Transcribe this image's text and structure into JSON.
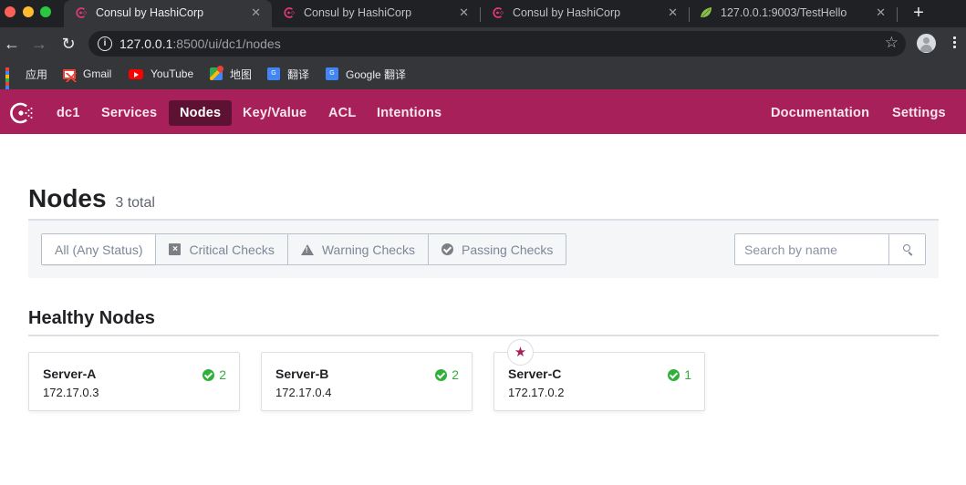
{
  "browser": {
    "tabs": [
      {
        "title": "Consul by HashiCorp",
        "favicon": "consul-icon",
        "active": true
      },
      {
        "title": "Consul by HashiCorp",
        "favicon": "consul-icon",
        "active": false
      },
      {
        "title": "Consul by HashiCorp",
        "favicon": "consul-icon",
        "active": false
      },
      {
        "title": "127.0.0.1:9003/TestHello",
        "favicon": "spring-leaf-icon",
        "active": false
      }
    ],
    "new_tab_label": "+",
    "close_glyph": "✕",
    "url_host": "127.0.0.1",
    "url_rest": ":8500/ui/dc1/nodes",
    "bookmarks": [
      {
        "label": "应用",
        "icon": "apps-grid-icon"
      },
      {
        "label": "Gmail",
        "icon": "gmail-icon"
      },
      {
        "label": "YouTube",
        "icon": "youtube-icon"
      },
      {
        "label": "地图",
        "icon": "maps-icon"
      },
      {
        "label": "翻译",
        "icon": "translate-icon"
      },
      {
        "label": "Google 翻译",
        "icon": "translate-icon"
      }
    ]
  },
  "colors": {
    "brand": "#a82059",
    "brand_active": "#5e1233",
    "passing": "#2eb039"
  },
  "nav": {
    "datacenter": "dc1",
    "items": [
      {
        "label": "Services",
        "active": false
      },
      {
        "label": "Nodes",
        "active": true
      },
      {
        "label": "Key/Value",
        "active": false
      },
      {
        "label": "ACL",
        "active": false
      },
      {
        "label": "Intentions",
        "active": false
      }
    ],
    "right_items": [
      {
        "label": "Documentation"
      },
      {
        "label": "Settings"
      }
    ]
  },
  "page": {
    "title": "Nodes",
    "count_label": "3 total",
    "filters": [
      {
        "label": "All (Any Status)",
        "icon": "",
        "selected": true
      },
      {
        "label": "Critical Checks",
        "icon": "critical-x-icon",
        "selected": false
      },
      {
        "label": "Warning Checks",
        "icon": "warning-triangle-icon",
        "selected": false
      },
      {
        "label": "Passing Checks",
        "icon": "passing-check-icon",
        "selected": false
      }
    ],
    "search": {
      "placeholder": "Search by name",
      "value": ""
    },
    "section_title": "Healthy Nodes",
    "nodes": [
      {
        "name": "Server-A",
        "address": "172.17.0.3",
        "passing": "2",
        "leader": false
      },
      {
        "name": "Server-B",
        "address": "172.17.0.4",
        "passing": "2",
        "leader": false
      },
      {
        "name": "Server-C",
        "address": "172.17.0.2",
        "passing": "1",
        "leader": true
      }
    ],
    "leader_glyph": "★"
  }
}
